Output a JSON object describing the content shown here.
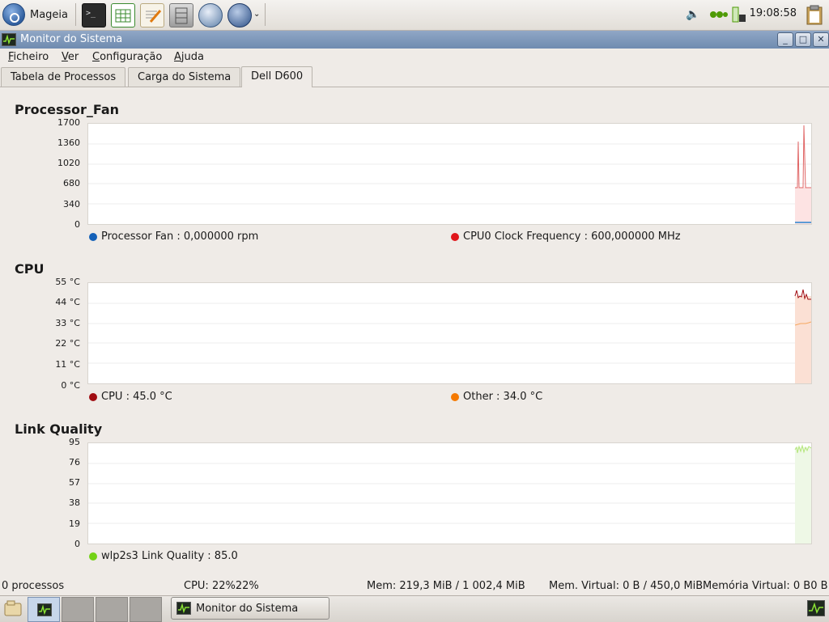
{
  "panel": {
    "menu_label": "Mageia",
    "clock": "19:08:58"
  },
  "window": {
    "title": "Monitor do Sistema"
  },
  "menubar": [
    "Ficheiro",
    "Ver",
    "Configuração",
    "Ajuda"
  ],
  "tabs": [
    "Tabela de Processos",
    "Carga do Sistema",
    "Dell D600"
  ],
  "sections": [
    {
      "title": "Processor_Fan",
      "yticks": [
        "1700",
        "1360",
        "1020",
        "680",
        "340",
        "0"
      ],
      "legend": [
        {
          "label": "Processor Fan : 0,000000 rpm",
          "color": "#1461b8"
        },
        {
          "label": "CPU0 Clock Frequency : 600,000000 MHz",
          "color": "#e0161b"
        }
      ]
    },
    {
      "title": "CPU",
      "yticks": [
        "55 °C",
        "44 °C",
        "33 °C",
        "22 °C",
        "11 °C",
        "0 °C"
      ],
      "legend": [
        {
          "label": "CPU : 45.0 °C",
          "color": "#a10d12"
        },
        {
          "label": "Other : 34.0 °C",
          "color": "#f57900"
        }
      ]
    },
    {
      "title": "Link Quality",
      "yticks": [
        "95",
        "76",
        "57",
        "38",
        "19",
        "0"
      ],
      "legend": [
        {
          "label": "wlp2s3 Link Quality : 85.0",
          "color": "#73d216"
        }
      ]
    }
  ],
  "status": {
    "processes": "0 processos",
    "cpu": "CPU: 22%22%",
    "mem": "Mem: 219,3 MiB / 1 002,4 MiB",
    "vmem": "Mem. Virtual: 0 B / 450,0 MiB",
    "vmem2": "Memória Virtual: 0 B0 B"
  },
  "taskbar": {
    "task_label": "Monitor do Sistema"
  },
  "colors": {
    "titlebar": "#7c96b9",
    "fan_fill": "#fde3e3",
    "cpu_fill": "#fbe0d4",
    "link_fill": "#eef8e6"
  }
}
